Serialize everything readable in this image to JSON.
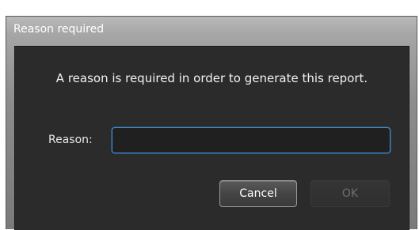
{
  "dialog": {
    "title": "Reason required",
    "message": "A reason is required in order to generate this report.",
    "reason_label": "Reason:",
    "reason_value": "",
    "reason_placeholder": "",
    "cancel_label": "Cancel",
    "ok_label": "OK"
  },
  "colors": {
    "accent_focus_border": "#3c8fd8",
    "content_background": "#2b2b2b",
    "disabled_text": "#6e6e6e"
  },
  "state": {
    "ok_button_enabled": false,
    "reason_input_focused": true
  }
}
